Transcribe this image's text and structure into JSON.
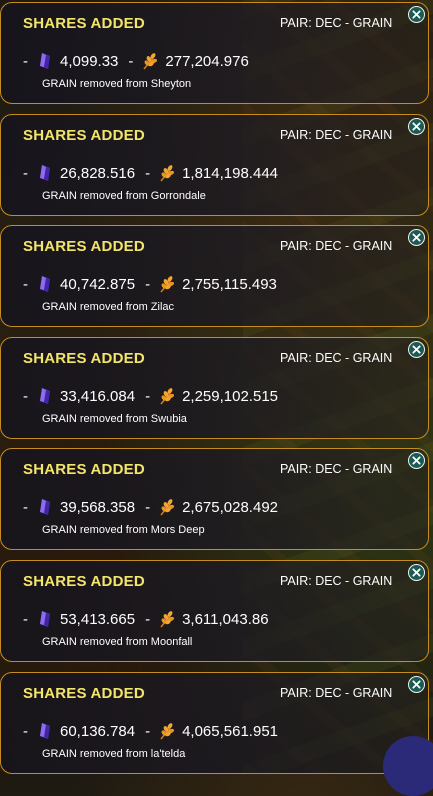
{
  "colors": {
    "title": "#f3e46a",
    "border": "#c58d1f",
    "close_bg": "#1d5a52",
    "crystal": "#6a3fd6",
    "grain": "#f2a531"
  },
  "icons": {
    "dec_token": "purple-crystal-icon",
    "grain_token": "wheat-grain-icon",
    "close": "close-x-icon"
  },
  "notifications": [
    {
      "title": "SHARES ADDED",
      "pair": "PAIR: DEC - GRAIN",
      "dash": "-",
      "dec_amount": "4,099.33",
      "grain_amount": "277,204.976",
      "detail": "GRAIN removed from Sheyton"
    },
    {
      "title": "SHARES ADDED",
      "pair": "PAIR: DEC - GRAIN",
      "dash": "-",
      "dec_amount": "26,828.516",
      "grain_amount": "1,814,198.444",
      "detail": "GRAIN removed from Gorrondale"
    },
    {
      "title": "SHARES ADDED",
      "pair": "PAIR: DEC - GRAIN",
      "dash": "-",
      "dec_amount": "40,742.875",
      "grain_amount": "2,755,115.493",
      "detail": "GRAIN removed from Zilac"
    },
    {
      "title": "SHARES ADDED",
      "pair": "PAIR: DEC - GRAIN",
      "dash": "-",
      "dec_amount": "33,416.084",
      "grain_amount": "2,259,102.515",
      "detail": "GRAIN removed from Swubia"
    },
    {
      "title": "SHARES ADDED",
      "pair": "PAIR: DEC - GRAIN",
      "dash": "-",
      "dec_amount": "39,568.358",
      "grain_amount": "2,675,028.492",
      "detail": "GRAIN removed from Mors Deep"
    },
    {
      "title": "SHARES ADDED",
      "pair": "PAIR: DEC - GRAIN",
      "dash": "-",
      "dec_amount": "53,413.665",
      "grain_amount": "3,611,043.86",
      "detail": "GRAIN removed from Moonfall"
    },
    {
      "title": "SHARES ADDED",
      "pair": "PAIR: DEC - GRAIN",
      "dash": "-",
      "dec_amount": "60,136.784",
      "grain_amount": "4,065,561.951",
      "detail": "GRAIN removed from la'telda"
    }
  ]
}
